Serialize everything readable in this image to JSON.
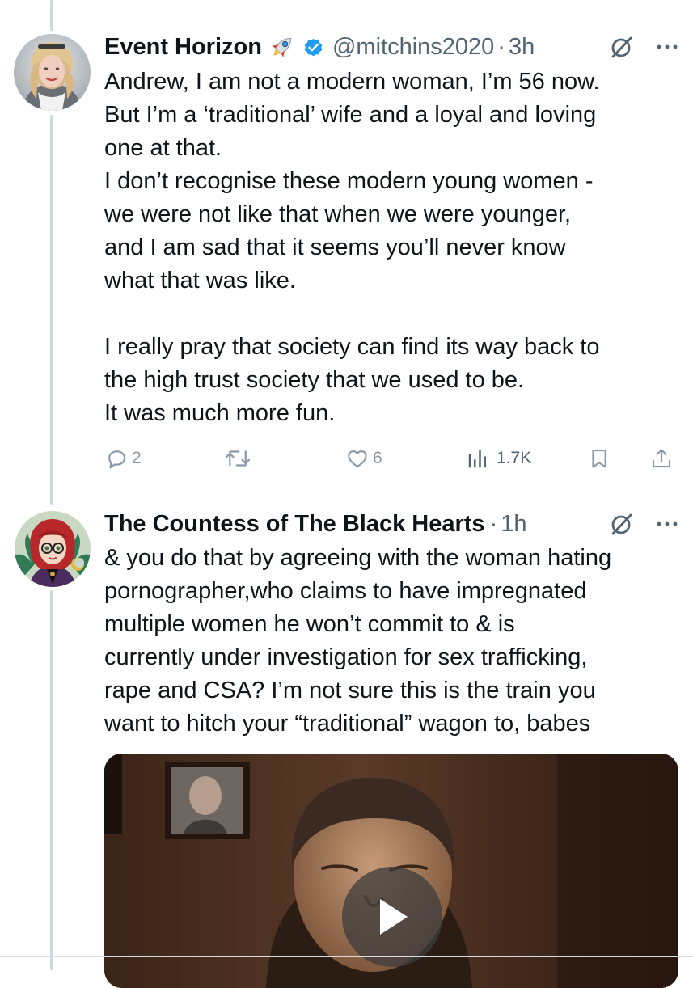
{
  "tweets": [
    {
      "display_name": "Event Horizon",
      "name_emoji": "🚀",
      "verified": true,
      "handle": "@mitchins2020",
      "separator": "·",
      "time": "3h",
      "body": [
        "Andrew, I am not a modern woman, I’m 56 now.",
        "But I’m a ‘traditional’ wife and a loyal and loving",
        "one at that.",
        "I don’t recognise these modern young women -",
        "we were not like that when we were younger,",
        "and I am sad that it seems you’ll never know",
        "what that was like.",
        "",
        "I really pray that society can find its way back to",
        "the high trust society that we used to be.",
        "It was much more fun."
      ],
      "actions": {
        "replies": "2",
        "reposts": "",
        "likes": "6",
        "views": "1.7K"
      }
    },
    {
      "display_name": "The Countess of The Black Hearts",
      "handle": "",
      "separator": "·",
      "time": "1h",
      "body": [
        "& you do that by agreeing with the woman hating",
        "pornographer,who claims to have impregnated",
        "multiple women he won’t commit to & is",
        "currently under investigation for sex trafficking,",
        "rape and CSA? I’m not sure this is the train you",
        "want to hitch your “traditional” wagon to, babes"
      ],
      "media": {
        "type": "video",
        "play_icon": "play-icon"
      }
    }
  ],
  "icons": {
    "grok": "grok-icon",
    "more": "more-icon",
    "reply": "reply-icon",
    "repost": "repost-icon",
    "like": "like-icon",
    "views": "views-icon",
    "bookmark": "bookmark-icon",
    "share": "share-icon",
    "verified": "verified-badge-icon",
    "rocket": "rocket-emoji"
  },
  "colors": {
    "text": "#0f1419",
    "secondary": "#536471",
    "action_gray": "#8b98a5",
    "verified_blue": "#1d9bf0",
    "thread_line": "#cfd9de"
  }
}
